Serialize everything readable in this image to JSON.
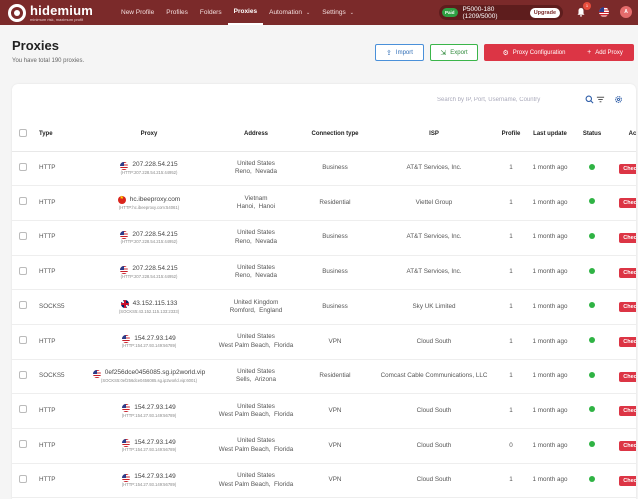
{
  "app": {
    "logo_name": "hidemium",
    "logo_tagline": "minimum risk, maximum profit",
    "nav": [
      {
        "label": "New Profile"
      },
      {
        "label": "Profiles"
      },
      {
        "label": "Folders"
      },
      {
        "label": "Proxies",
        "active": true
      },
      {
        "label": "Automation",
        "has_caret": true
      },
      {
        "label": "Settings",
        "has_caret": true
      }
    ],
    "plan_badge": "Paid",
    "plan_text": "P5000-180 (1209/5000)",
    "upgrade_label": "Upgrade",
    "notification_count": "1",
    "avatar_initial": "A",
    "brand_color": "#7b2a2a",
    "accent_red": "#dc3545"
  },
  "page": {
    "title": "Proxies",
    "subtitle": "You have total 190 proxies.",
    "buttons": {
      "import": "Import",
      "export": "Export",
      "config": "Proxy Configuration",
      "add": "Add Proxy"
    },
    "search_placeholder": "Search by IP, Port, Username, Country"
  },
  "table": {
    "columns": [
      "Type",
      "Proxy",
      "Address",
      "Connection type",
      "ISP",
      "Profile",
      "Last update",
      "Status",
      "Action"
    ],
    "check_label": "Check",
    "rows": [
      {
        "type": "HTTP",
        "flag": "us",
        "proxy": "207.228.54.215",
        "proxy_full": "(HTTP:207.228.54.215:44952)",
        "country": "United States",
        "city": "Reno,  Nevada",
        "connection": "Business",
        "isp": "AT&T Services, Inc.",
        "profile": "1",
        "updated": "1 month ago"
      },
      {
        "type": "HTTP",
        "flag": "vn",
        "proxy": "hc.ibeeproxy.com",
        "proxy_full": "(HTTP:hc.ibeeproxy.com:54061)",
        "country": "Vietnam",
        "city": "Hanoi,  Hanoi",
        "connection": "Residential",
        "isp": "Viettel Group",
        "profile": "1",
        "updated": "1 month ago"
      },
      {
        "type": "HTTP",
        "flag": "us",
        "proxy": "207.228.54.215",
        "proxy_full": "(HTTP:207.228.54.215:44952)",
        "country": "United States",
        "city": "Reno,  Nevada",
        "connection": "Business",
        "isp": "AT&T Services, Inc.",
        "profile": "1",
        "updated": "1 month ago"
      },
      {
        "type": "HTTP",
        "flag": "us",
        "proxy": "207.228.54.215",
        "proxy_full": "(HTTP:207.228.54.215:44952)",
        "country": "United States",
        "city": "Reno,  Nevada",
        "connection": "Business",
        "isp": "AT&T Services, Inc.",
        "profile": "1",
        "updated": "1 month ago"
      },
      {
        "type": "SOCKS5",
        "flag": "gb",
        "proxy": "43.152.115.133",
        "proxy_full": "(SOCKS5:43.152.115.133:2333)",
        "country": "United Kingdom",
        "city": "Romford,  England",
        "connection": "Business",
        "isp": "Sky UK Limited",
        "profile": "1",
        "updated": "1 month ago"
      },
      {
        "type": "HTTP",
        "flag": "us",
        "proxy": "154.27.93.149",
        "proxy_full": "(HTTP:154.27.93.149:56789)",
        "country": "United States",
        "city": "West Palm Beach,  Florida",
        "connection": "VPN",
        "isp": "Cloud South",
        "profile": "1",
        "updated": "1 month ago"
      },
      {
        "type": "SOCKS5",
        "flag": "us",
        "proxy": "0ef256dce0456085.sg.ip2world.vip",
        "proxy_full": "(SOCKS5:0ef256dce0456085.sg.ip2world.vip:6001)",
        "country": "United States",
        "city": "Sells,  Arizona",
        "connection": "Residential",
        "isp": "Comcast Cable Communications, LLC",
        "profile": "1",
        "updated": "1 month ago"
      },
      {
        "type": "HTTP",
        "flag": "us",
        "proxy": "154.27.93.149",
        "proxy_full": "(HTTP:154.27.93.149:56789)",
        "country": "United States",
        "city": "West Palm Beach,  Florida",
        "connection": "VPN",
        "isp": "Cloud South",
        "profile": "1",
        "updated": "1 month ago"
      },
      {
        "type": "HTTP",
        "flag": "us",
        "proxy": "154.27.93.149",
        "proxy_full": "(HTTP:154.27.93.149:56789)",
        "country": "United States",
        "city": "West Palm Beach,  Florida",
        "connection": "VPN",
        "isp": "Cloud South",
        "profile": "0",
        "updated": "1 month ago"
      },
      {
        "type": "HTTP",
        "flag": "us",
        "proxy": "154.27.93.149",
        "proxy_full": "(HTTP:154.27.93.149:56789)",
        "country": "United States",
        "city": "West Palm Beach,  Florida",
        "connection": "VPN",
        "isp": "Cloud South",
        "profile": "1",
        "updated": "1 month ago"
      }
    ]
  }
}
